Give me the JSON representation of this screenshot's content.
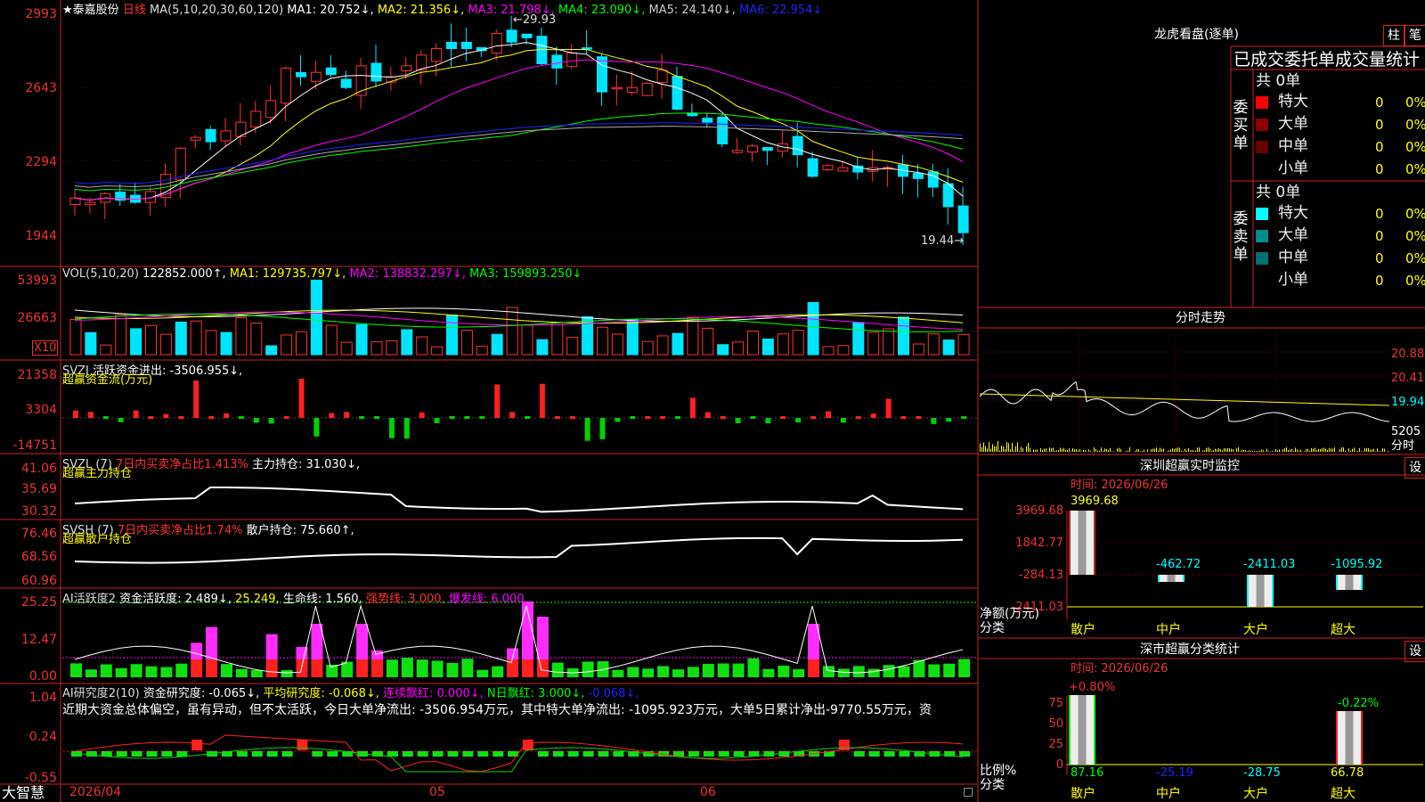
{
  "stock": {
    "star": "★",
    "name": "泰嘉股份",
    "period": "日线"
  },
  "ma_header": {
    "label": "MA(5,10,20,30,60,120)",
    "ma1": "MA1: 20.752↓,",
    "ma2": "MA2: 21.356↓,",
    "ma3": "MA3: 21.798↓,",
    "ma4": "MA4: 23.090↓,",
    "ma5": "MA5: 24.140↓,",
    "ma6": "MA6: 22.954↓"
  },
  "price_axis": [
    "2993",
    "2643",
    "2294",
    "1944"
  ],
  "price_high_label": "29.93",
  "price_low_label": "19.44",
  "vol": {
    "header": "VOL(5,10,20)",
    "value": "122852.000↑,",
    "ma1": "MA1: 129735.797↓,",
    "ma2": "MA2: 138832.297↓,",
    "ma3": "MA3: 159893.250↓",
    "axis": [
      "53993",
      "26663"
    ],
    "unit": "X10"
  },
  "svzj": {
    "name": "SVZJ",
    "label": "活跃资金进出: -3506.955↓,",
    "sub": "超赢资金流(万元)",
    "axis": [
      "21358",
      "3304",
      "-14751"
    ]
  },
  "svzl": {
    "name": "SVZL (7)",
    "label1": "7日内买卖净占比1.413%",
    "label2": "主力持仓: 31.030↓,",
    "sub": "超赢主力持仓",
    "axis": [
      "41.06",
      "35.69",
      "30.32"
    ]
  },
  "svsh": {
    "name": "SVSH (7)",
    "label1": "7日内买卖净占比1.74%",
    "label2": "散户持仓: 75.660↑,",
    "sub": "超赢散户持仓",
    "axis": [
      "76.46",
      "68.56",
      "60.96"
    ]
  },
  "ai2": {
    "name": "AI活跃度2",
    "label1": "资金活跃度: 2.489↓,",
    "label2": "25.249,",
    "label3": "生命线: 1.560,",
    "label4": "强势线: 3.000,",
    "label5": "爆发线: 6.000,",
    "axis": [
      "25.25",
      "12.47",
      "0.00"
    ]
  },
  "ai3": {
    "name": "AI研究度2(10)",
    "label1": "资金研究度: -0.065↓,",
    "label2": "平均研究度: -0.068↓,",
    "label3": "连续飘红: 0.000↓,",
    "label4": "N日飘红: 3.000↓,",
    "label5": "-0.068↓,",
    "text": "近期大资金总体偏空，虽有异动，但不太活跃，今日大单净流出: -3506.954万元，其中特大单净流出: -1095.923万元，大单5日累计净出-9770.55万元，资",
    "axis": [
      "1.04",
      "0.24",
      "-0.55"
    ]
  },
  "bottom": {
    "logo": "大智慧",
    "date": "2026/04",
    "m05": "05",
    "m06": "06"
  },
  "lhb": {
    "title": "龙虎看盘(逐单)",
    "btn1": "柱",
    "btn2": "笔",
    "subtitle": "已成交委托单成交量统计",
    "buy_label": "委买单",
    "sell_label": "委卖单",
    "total": "共 0单",
    "rows": [
      {
        "name": "特大",
        "v": "0",
        "p": "0%"
      },
      {
        "name": "大单",
        "v": "0",
        "p": "0%"
      },
      {
        "name": "中单",
        "v": "0",
        "p": "0%"
      },
      {
        "name": "小单",
        "v": "0",
        "p": "0%"
      }
    ],
    "buy_colors": [
      "#ff0000",
      "#8b0000",
      "#6a0000",
      "#000000"
    ],
    "sell_colors": [
      "#00ffff",
      "#008b8b",
      "#007070",
      "#000000"
    ]
  },
  "fenshi": {
    "title": "分时走势",
    "axis": [
      "20.88",
      "20.41",
      "19.94",
      "5205",
      "分时"
    ]
  },
  "sz_monitor": {
    "title": "深圳超赢实时监控",
    "btn": "设",
    "time": "时间: 2026/06/26",
    "axis": [
      "3969.68",
      "1842.77",
      "-284.13",
      "-2411.03"
    ],
    "ylabel": "净额(万元)",
    "xlabel": "分类",
    "bars": [
      {
        "cat": "散户",
        "val": "3969.68"
      },
      {
        "cat": "中户",
        "val": "-462.72"
      },
      {
        "cat": "大户",
        "val": "-2411.03"
      },
      {
        "cat": "超大",
        "val": "-1095.92"
      }
    ]
  },
  "sz_class": {
    "title": "深市超赢分类统计",
    "btn": "设",
    "time": "时间: 2026/06/26",
    "axis": [
      "75",
      "50",
      "25",
      "0"
    ],
    "ylabel": "比例%",
    "xlabel": "分类",
    "top1": "+0.80%",
    "top4": "-0.22%",
    "bars": [
      {
        "cat": "散户",
        "val": "87.16"
      },
      {
        "cat": "中户",
        "val": "-25.19"
      },
      {
        "cat": "大户",
        "val": "-28.75"
      },
      {
        "cat": "超大",
        "val": "66.78"
      }
    ]
  }
}
